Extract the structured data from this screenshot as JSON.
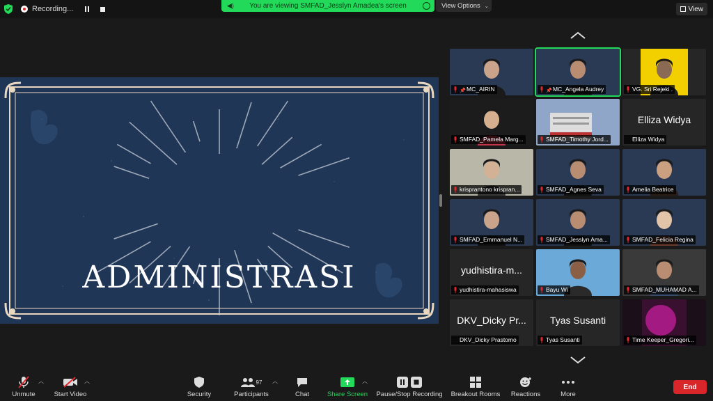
{
  "topbar": {
    "recording_label": "Recording...",
    "viewing_banner": "You are viewing SMFAD_Jesslyn Amadea's screen",
    "view_options": "View Options",
    "view_button": "View"
  },
  "slide": {
    "title": "ADMINISTRASI",
    "colors": {
      "background": "#1f3657",
      "frame": "#e9d7bf",
      "text": "#ffffff"
    }
  },
  "gallery": {
    "tiles": [
      {
        "name": "MC_AIRIN",
        "pinned": true,
        "muted": true
      },
      {
        "name": "MC_Angela Audrey",
        "pinned": true,
        "muted": true,
        "active": true
      },
      {
        "name": "VG. Sri Rejeki .",
        "muted": true
      },
      {
        "name": "SMFAD_Pamela Marg...",
        "muted": true
      },
      {
        "name": "SMFAD_Timothy Jord...",
        "muted": true
      },
      {
        "name": "Elliza Widya",
        "muted": false,
        "display_name": "Elliza Widya"
      },
      {
        "name": "krisprantono krispran...",
        "muted": true
      },
      {
        "name": "SMFAD_Agnes Seva",
        "muted": true
      },
      {
        "name": "Amelia Beatrice",
        "muted": true
      },
      {
        "name": "SMFAD_Emmanuel N...",
        "muted": true
      },
      {
        "name": "SMFAD_Jesslyn Ama...",
        "muted": true
      },
      {
        "name": "SMFAD_Felicia Regina",
        "muted": true
      },
      {
        "name": "yudhistira-mahasiswa",
        "muted": true,
        "display_name": "yudhistira-m..."
      },
      {
        "name": "Bayu Wi",
        "muted": true
      },
      {
        "name": "SMFAD_MUHAMAD A...",
        "muted": true
      },
      {
        "name": "DKV_Dicky Prastomo",
        "muted": false,
        "display_name": "DKV_Dicky Pr..."
      },
      {
        "name": "Tyas Susanti",
        "muted": true,
        "display_name": "Tyas Susanti"
      },
      {
        "name": "Time Keeper_Gregori...",
        "muted": true
      }
    ]
  },
  "toolbar": {
    "unmute": "Unmute",
    "start_video": "Start Video",
    "security": "Security",
    "participants": "Participants",
    "participants_count": "97",
    "chat": "Chat",
    "share_screen": "Share Screen",
    "pause_stop_recording": "Pause/Stop Recording",
    "breakout_rooms": "Breakout Rooms",
    "reactions": "Reactions",
    "more": "More",
    "end": "End"
  }
}
